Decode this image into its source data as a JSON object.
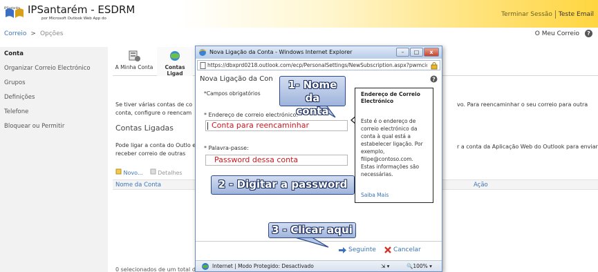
{
  "header": {
    "app_title": "IPSantarém - ESDRM",
    "app_subtitle": "por Microsoft Outlook Web App do",
    "signout": "Terminar Sessão",
    "user": "Teste Email",
    "accent_color": "#ffd640"
  },
  "breadcrumb": {
    "root": "Correio",
    "separator": ">",
    "current": "Opções"
  },
  "my_mail": "O Meu Correio",
  "sidebar": {
    "items": [
      {
        "label": "Conta",
        "selected": true
      },
      {
        "label": "Organizar Correio Electrónico"
      },
      {
        "label": "Grupos"
      },
      {
        "label": "Definições"
      },
      {
        "label": "Telefone"
      },
      {
        "label": "Bloquear ou Permitir"
      }
    ]
  },
  "toolbar": {
    "my_account": "A Minha Conta",
    "linked_accounts": "Contas Ligad"
  },
  "main": {
    "para1_left": "Se tiver várias contas de co conta, configure o reencam",
    "para1_right": "vo. Para reencaminhar o seu correio para outra",
    "section_title": "Contas Ligadas",
    "para2_left": "Pode ligar a conta do Outlo e receber correio de outras",
    "para2_right": "r a conta da Aplicação Web do Outlook para enviar",
    "new_btn": "Novo...",
    "details_btn": "Detalhes",
    "col_name": "Nome da Conta",
    "col_action": "Ação",
    "footer": "0 selecionados de um total d"
  },
  "popup": {
    "window_title": "Nova Ligação da Conta - Windows Internet Explorer",
    "url": "https://dbxprd0218.outlook.com/ecp/PersonalSettings/NewSubscription.aspx?pwmcic",
    "heading": "Nova Ligação da Con",
    "required_note": "*Campos obrigatórios",
    "email_label": "* Endereço de correio electrónico:",
    "email_value": "Conta para reencaminhar",
    "password_label": "* Palavra-passe:",
    "password_value": "Password dessa conta",
    "info_title": "Endereço de Correio Electrónico",
    "info_text": "Este é o endereço de correio electrónico da conta à qual está a estabelecer ligação. Por exemplo, filipe@contoso.com. Estas informações são necessárias.",
    "info_more": "Saiba Mais",
    "next_btn": "Seguinte",
    "cancel_btn": "Cancelar",
    "status_zone": "Internet | Modo Protegido: Desactivado",
    "status_zoom": "100%",
    "win_min": "–",
    "win_max": "□",
    "win_close": "x"
  },
  "callouts": {
    "step1_line1": "1- Nome da",
    "step1_line2": "conta",
    "step2": "2 - Digitar a password",
    "step3": "3 - Clicar aqui"
  },
  "icons": [
    "windows-logo-icon",
    "help-icon",
    "mailbox-icon",
    "globe-icon",
    "ie-icon",
    "lock-icon",
    "arrow-right-icon",
    "x-cancel-icon"
  ]
}
